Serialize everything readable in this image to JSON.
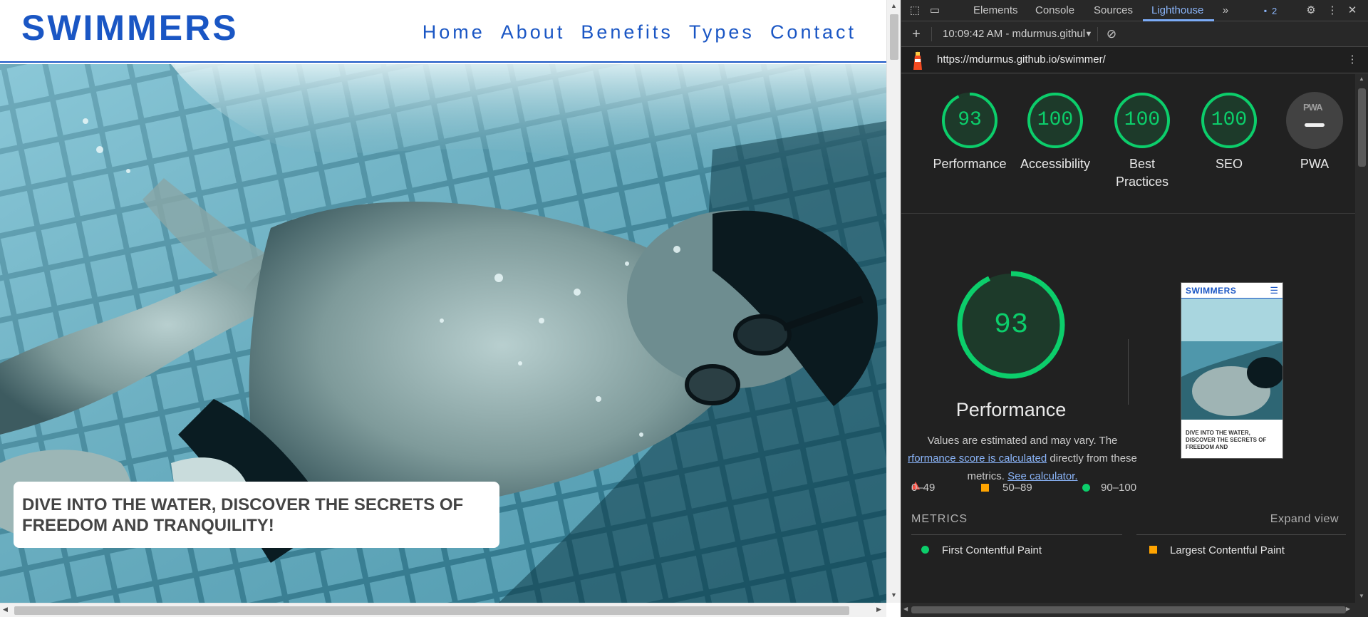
{
  "site": {
    "logo": "SWIMMERS",
    "nav": [
      "Home",
      "About",
      "Benefits",
      "Types",
      "Contact"
    ],
    "hero_caption": "DIVE INTO THE WATER, DISCOVER THE SECRETS OF FREEDOM AND TRANQUILITY!",
    "hero_image": "underwater swimmer with goggles"
  },
  "devtools": {
    "tabs": [
      "Elements",
      "Console",
      "Sources",
      "Lighthouse"
    ],
    "active_tab": "Lighthouse",
    "issues_count": "2",
    "toolbar": {
      "report_select": "10:09:42 AM - mdurmus.githul"
    },
    "url": "https://mdurmus.github.io/swimmer/",
    "scores": [
      {
        "label": "Performance",
        "value": "93",
        "color": "#0cce6b"
      },
      {
        "label": "Accessibility",
        "value": "100",
        "color": "#0cce6b"
      },
      {
        "label": "Best Practices",
        "value": "100",
        "color": "#0cce6b"
      },
      {
        "label": "SEO",
        "value": "100",
        "color": "#0cce6b"
      },
      {
        "label": "PWA",
        "value": "",
        "color": "#9e9e9e"
      }
    ],
    "pwa_badge": "PWA",
    "performance": {
      "score": "93",
      "title": "Performance",
      "desc_1": "Values are estimated and may vary. The",
      "desc_link_1": "rformance score is calculated",
      "desc_2": "directly from these",
      "desc_3": "metrics.",
      "desc_link_2": "See calculator."
    },
    "thumbnail": {
      "logo": "SWIMMERS",
      "caption": "DIVE INTO THE WATER, DISCOVER THE SECRETS OF FREEDOM AND"
    },
    "legend": [
      {
        "range": "0–49",
        "color": "#ff4e42"
      },
      {
        "range": "50–89",
        "color": "#ffa400"
      },
      {
        "range": "90–100",
        "color": "#0cce6b"
      }
    ],
    "metrics_header": "METRICS",
    "expand_view": "Expand view",
    "metrics": [
      {
        "label": "First Contentful Paint",
        "status": "green"
      },
      {
        "label": "Largest Contentful Paint",
        "status": "orange"
      }
    ]
  }
}
